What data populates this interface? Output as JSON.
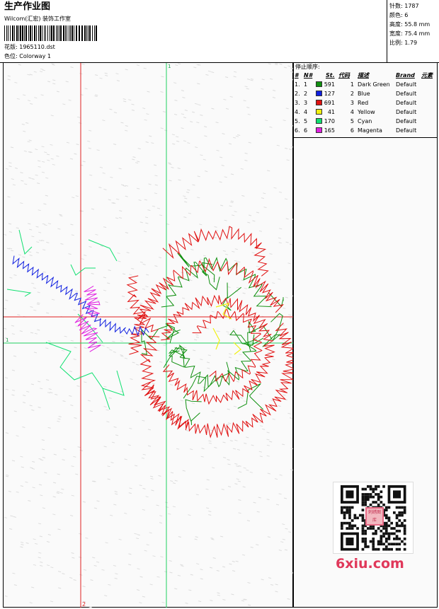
{
  "header": {
    "title": "生产作业图",
    "studio": "Wilcom(汇宏) 装饰工作室",
    "design_label": "花版:",
    "design_value": "1965110.dst",
    "colorway_label": "色位:",
    "colorway_value": "Colorway 1"
  },
  "stats": {
    "stitches": "针数: 1787",
    "colors": "颜色: 6",
    "height": "高度: 55.8 mm",
    "width": "宽度: 75.4 mm",
    "ratio": "比例: 1.79"
  },
  "canvas": {
    "marker_vertical_top": "1",
    "marker_horizontal_left": "1",
    "marker_vertical_bottom": "2"
  },
  "stop_sequence": {
    "title": "停止顺序:",
    "headers": [
      "#",
      "N#",
      "St.",
      "代码",
      "描述",
      "Brand",
      "元素"
    ],
    "rows": [
      {
        "idx": "1.",
        "n": "1",
        "color": "#109010",
        "st": "591",
        "code": "1",
        "desc": "Dark Green",
        "brand": "Default"
      },
      {
        "idx": "2.",
        "n": "2",
        "color": "#1020e0",
        "st": "127",
        "code": "2",
        "desc": "Blue",
        "brand": "Default"
      },
      {
        "idx": "3.",
        "n": "3",
        "color": "#e01010",
        "st": "691",
        "code": "3",
        "desc": "Red",
        "brand": "Default"
      },
      {
        "idx": "4.",
        "n": "4",
        "color": "#f0f010",
        "st": "41",
        "code": "4",
        "desc": "Yellow",
        "brand": "Default"
      },
      {
        "idx": "5.",
        "n": "5",
        "color": "#10e070",
        "st": "170",
        "code": "5",
        "desc": "Cyan",
        "brand": "Default"
      },
      {
        "idx": "6.",
        "n": "6",
        "color": "#e020e0",
        "st": "165",
        "code": "6",
        "desc": "Magenta",
        "brand": "Default"
      }
    ]
  },
  "watermark": {
    "text": "6xiu.com",
    "badge": "刺绣图库"
  },
  "colors": {
    "red_thread": "#e01010",
    "green_thread": "#109010",
    "cyan_thread": "#10e070",
    "blue_thread": "#1020e0",
    "magenta_thread": "#e020e0",
    "yellow_thread": "#f0f010",
    "guide_red": "#e02020",
    "guide_green": "#20d060"
  }
}
